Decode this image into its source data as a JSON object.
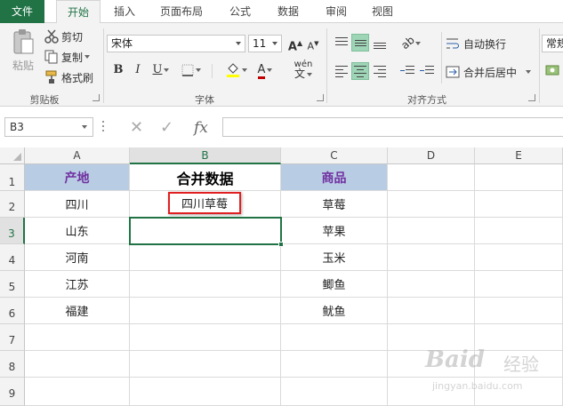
{
  "tabs": [
    {
      "label": "文件"
    },
    {
      "label": "开始"
    },
    {
      "label": "插入"
    },
    {
      "label": "页面布局"
    },
    {
      "label": "公式"
    },
    {
      "label": "数据"
    },
    {
      "label": "审阅"
    },
    {
      "label": "视图"
    }
  ],
  "ribbon": {
    "clipboard": {
      "paste": "粘贴",
      "cut": "剪切",
      "copy": "复制",
      "format_painter": "格式刷",
      "group": "剪贴板"
    },
    "font": {
      "name": "宋体",
      "size": "11",
      "bold": "B",
      "italic": "I",
      "underline": "U",
      "group": "字体",
      "grow": "A",
      "shrink": "A",
      "font_color": "A",
      "wen": "wén"
    },
    "alignment": {
      "wrap": "自动换行",
      "merge": "合并后居中",
      "group": "对齐方式"
    },
    "number": {
      "format": "常规"
    }
  },
  "formula_bar": {
    "name_box": "B3",
    "fx": "fx",
    "value": ""
  },
  "grid": {
    "columns": [
      "A",
      "B",
      "C",
      "D",
      "E"
    ],
    "rows": [
      "1",
      "2",
      "3",
      "4",
      "5",
      "6",
      "7",
      "8",
      "9"
    ],
    "selected_cell": "B3",
    "cells": {
      "A1": "产地",
      "B1": "合并数据",
      "C1": "商品",
      "A2": "四川",
      "B2": "四川草莓",
      "C2": "草莓",
      "A3": "山东",
      "C3": "苹果",
      "A4": "河南",
      "C4": "玉米",
      "A5": "江苏",
      "C5": "鲫鱼",
      "A6": "福建",
      "C6": "鱿鱼"
    }
  },
  "watermark": {
    "brand": "Baid",
    "suffix": "经验",
    "url": "jingyan.baidu.com"
  },
  "colors": {
    "excel_green": "#217346",
    "header_fill": "#b8cce4",
    "header_text": "#7030a0",
    "highlight_border": "#e02020"
  }
}
